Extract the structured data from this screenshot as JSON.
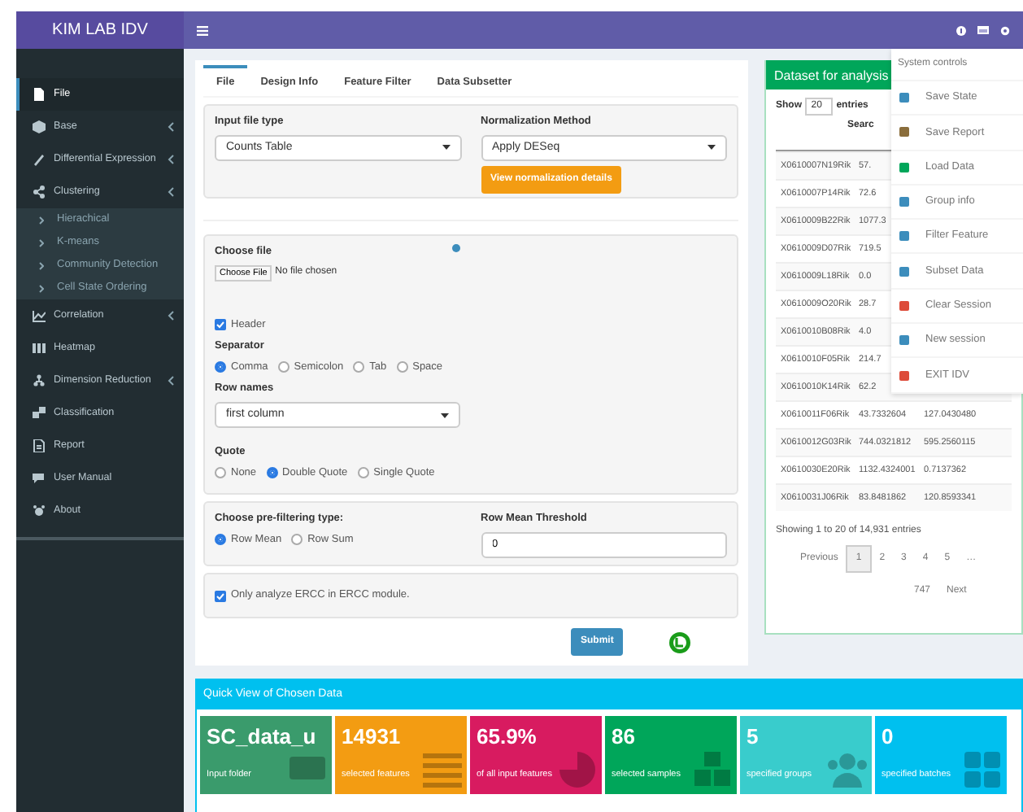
{
  "app": {
    "title": "KIM LAB IDV"
  },
  "sidebar": {
    "items": [
      {
        "label": "File",
        "selected": true,
        "expandable": false
      },
      {
        "label": "Base",
        "selected": false,
        "expandable": true
      },
      {
        "label": "Differential Expression",
        "selected": false,
        "expandable": true
      },
      {
        "label": "Clustering",
        "selected": false,
        "expandable": true,
        "children": [
          {
            "label": "Hierachical"
          },
          {
            "label": "K-means"
          },
          {
            "label": "Community Detection"
          },
          {
            "label": "Cell State Ordering"
          }
        ]
      },
      {
        "label": "Correlation",
        "selected": false,
        "expandable": true
      },
      {
        "label": "Heatmap",
        "selected": false,
        "expandable": false
      },
      {
        "label": "Dimension Reduction",
        "selected": false,
        "expandable": true
      },
      {
        "label": "Classification",
        "selected": false,
        "expandable": false
      },
      {
        "label": "Report",
        "selected": false,
        "expandable": false
      },
      {
        "label": "User Manual",
        "selected": false,
        "expandable": false
      },
      {
        "label": "About",
        "selected": false,
        "expandable": false
      }
    ]
  },
  "tabs": [
    {
      "label": "File",
      "selected": true
    },
    {
      "label": "Design Info",
      "selected": false
    },
    {
      "label": "Feature Filter",
      "selected": false
    },
    {
      "label": "Data Subsetter",
      "selected": false
    }
  ],
  "input_file_type": {
    "label": "Input file type",
    "value": "Counts Table"
  },
  "normalization": {
    "label": "Normalization Method",
    "value": "Apply DESeq",
    "button": "View normalization details"
  },
  "choose_file": {
    "label": "Choose file",
    "button": "Choose File",
    "status": "No file chosen"
  },
  "header_checkbox": {
    "label": "Header",
    "checked": true
  },
  "separator": {
    "label": "Separator",
    "options": [
      {
        "label": "Comma",
        "selected": true
      },
      {
        "label": "Semicolon",
        "selected": false
      },
      {
        "label": "Tab",
        "selected": false
      },
      {
        "label": "Space",
        "selected": false
      }
    ]
  },
  "row_names": {
    "label": "Row names",
    "value": "first column"
  },
  "quote": {
    "label": "Quote",
    "options": [
      {
        "label": "None",
        "selected": false
      },
      {
        "label": "Double Quote",
        "selected": true
      },
      {
        "label": "Single Quote",
        "selected": false
      }
    ]
  },
  "prefilter": {
    "label": "Choose pre-filtering type:",
    "options": [
      {
        "label": "Row Mean",
        "selected": true
      },
      {
        "label": "Row Sum",
        "selected": false
      }
    ]
  },
  "threshold": {
    "label": "Row Mean Threshold",
    "value": "0"
  },
  "ercc_checkbox": {
    "label": "Only analyze ERCC in ERCC module.",
    "checked": true
  },
  "submit": {
    "label": "Submit"
  },
  "dataset": {
    "title": "Dataset for analysis",
    "show_label": "Show",
    "page_size": "20",
    "entries_label": "entries",
    "search_label": "Searc",
    "rows": [
      [
        "X0610007N19Rik",
        "57."
      ],
      [
        "X0610007P14Rik",
        "72.6"
      ],
      [
        "X0610009B22Rik",
        "1077.3"
      ],
      [
        "X0610009D07Rik",
        "719.5"
      ],
      [
        "X0610009L18Rik",
        "0.0"
      ],
      [
        "X0610009O20Rik",
        "28.7"
      ],
      [
        "X0610010B08Rik",
        "4.0"
      ],
      [
        "X0610010F05Rik",
        "214.7"
      ],
      [
        "X0610010K14Rik",
        "62.2"
      ],
      [
        "X0610011F06Rik",
        "43.7332604",
        "127.0430480"
      ],
      [
        "X0610012G03Rik",
        "744.0321812",
        "595.2560115"
      ],
      [
        "X0610030E20Rik",
        "1132.4324001",
        "0.7137362"
      ],
      [
        "X0610031J06Rik",
        "83.8481862",
        "120.8593341"
      ]
    ],
    "info": "Showing 1 to 20 of 14,931 entries",
    "pagination": [
      {
        "label": "Previous",
        "selected": false
      },
      {
        "label": "1",
        "selected": true
      },
      {
        "label": "2",
        "selected": false
      },
      {
        "label": "3",
        "selected": false
      },
      {
        "label": "4",
        "selected": false
      },
      {
        "label": "5",
        "selected": false
      },
      {
        "label": "…",
        "selected": false
      },
      {
        "label": "747",
        "selected": false
      },
      {
        "label": "Next",
        "selected": false
      }
    ]
  },
  "system_menu": {
    "header": "System controls",
    "items": [
      {
        "label": "Save State",
        "color": "#3c8dbc"
      },
      {
        "label": "Save Report",
        "color": "#8a6d3b"
      },
      {
        "label": "Load Data",
        "color": "#00a65a"
      },
      {
        "label": "Group info",
        "color": "#3c8dbc"
      },
      {
        "label": "Filter Feature",
        "color": "#3c8dbc"
      },
      {
        "label": "Subset Data",
        "color": "#3c8dbc"
      },
      {
        "label": "Clear Session",
        "color": "#dd4b39"
      },
      {
        "label": "New session",
        "color": "#3c8dbc"
      },
      {
        "label": "EXIT IDV",
        "color": "#dd4b39"
      }
    ]
  },
  "quick_view": {
    "title": "Quick View of Chosen Data",
    "boxes": [
      {
        "value": "SC_data_u",
        "caption": "Input folder",
        "color": "#3a9b6c"
      },
      {
        "value": "14931",
        "caption": "selected features",
        "color": "#f39c12"
      },
      {
        "value": "65.9%",
        "caption": "of all input features",
        "color": "#d81b60"
      },
      {
        "value": "86",
        "caption": "selected samples",
        "color": "#00a65a"
      },
      {
        "value": "5",
        "caption": "specified groups",
        "color": "#39cccc"
      },
      {
        "value": "0",
        "caption": "specified batches",
        "color": "#00c0ef"
      }
    ]
  }
}
